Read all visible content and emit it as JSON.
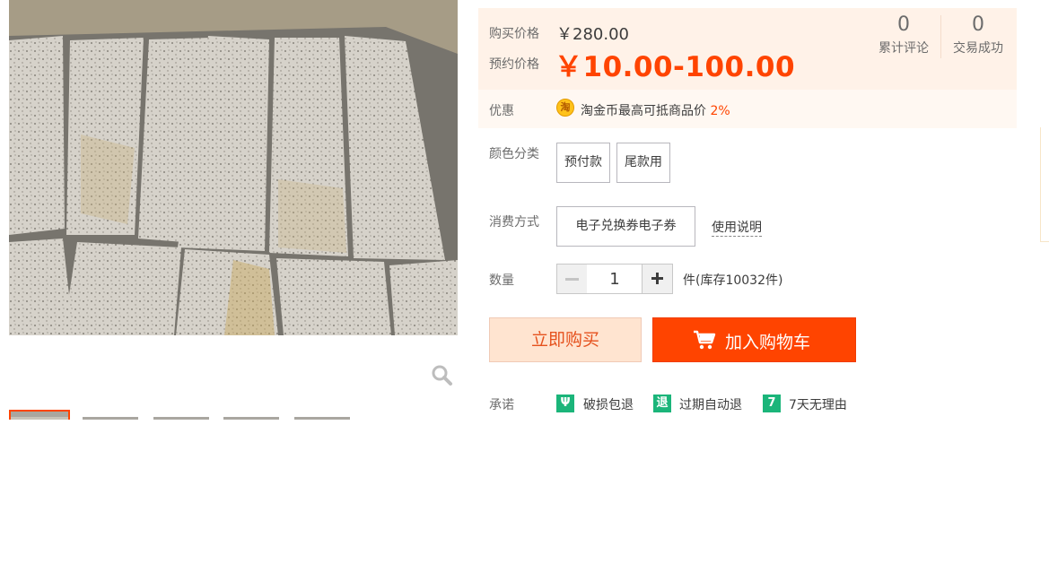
{
  "gallery": {
    "main_image": "granite-paving-stones-photo",
    "zoom_icon": "magnifier-icon",
    "thumbnails": [
      {
        "name": "thumb-1",
        "selected": true
      },
      {
        "name": "thumb-2",
        "selected": false
      },
      {
        "name": "thumb-3",
        "selected": false
      },
      {
        "name": "thumb-4",
        "selected": false
      },
      {
        "name": "thumb-5",
        "selected": false
      }
    ]
  },
  "price": {
    "buy_label": "购买价格",
    "buy_value": "￥280.00",
    "pre_label": "预约价格",
    "pre_value": "￥10.00-100.00",
    "accent_color": "#ff4400"
  },
  "stats": [
    {
      "count": "0",
      "label": "累计评论"
    },
    {
      "count": "0",
      "label": "交易成功"
    }
  ],
  "promo": {
    "label": "优惠",
    "coin_icon": "淘",
    "text": "淘金币最高可抵商品价",
    "percent": "2%"
  },
  "color_category": {
    "label": "颜色分类",
    "options": [
      "预付款",
      "尾款用"
    ]
  },
  "consumption": {
    "label": "消费方式",
    "option": "电子兑换券电子券",
    "help_link": "使用说明"
  },
  "quantity": {
    "label": "数量",
    "value": "1",
    "minus_icon": "minus-icon",
    "plus_icon": "plus-icon",
    "stock_text": "件(库存10032件)"
  },
  "actions": {
    "buy_now": "立即购买",
    "add_to_cart": "加入购物车",
    "cart_icon": "shopping-cart-icon"
  },
  "promise": {
    "label": "承诺",
    "items": [
      {
        "icon": "damage-return-icon",
        "glyph": "Ψ",
        "text": "破损包退"
      },
      {
        "icon": "auto-refund-icon",
        "glyph": "退",
        "text": "过期自动退"
      },
      {
        "icon": "seven-day-icon",
        "glyph": "7",
        "text": "7天无理由"
      }
    ]
  }
}
